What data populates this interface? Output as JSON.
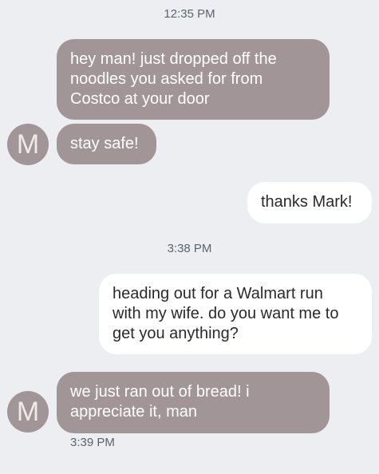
{
  "timestamps": [
    "12:35 PM",
    "3:38 PM"
  ],
  "messages": [
    {
      "from": "incoming",
      "text": "hey man! just dropped off the\nnoodles you asked for from\nCostco at your door"
    },
    {
      "from": "incoming",
      "text": "stay safe!"
    },
    {
      "from": "outgoing",
      "text": "thanks Mark!"
    },
    {
      "from": "outgoing",
      "text": "heading out for a Walmart run\nwith my wife. do you want me to\nget you anything?"
    },
    {
      "from": "incoming",
      "text": "we just ran out of bread! i\nappreciate it, man"
    }
  ],
  "contact_initial": "M",
  "last_message_time": "3:39 PM",
  "colors": {
    "background": "#eceef1",
    "incoming_bubble": "#a29597",
    "outgoing_bubble": "#ffffff"
  }
}
